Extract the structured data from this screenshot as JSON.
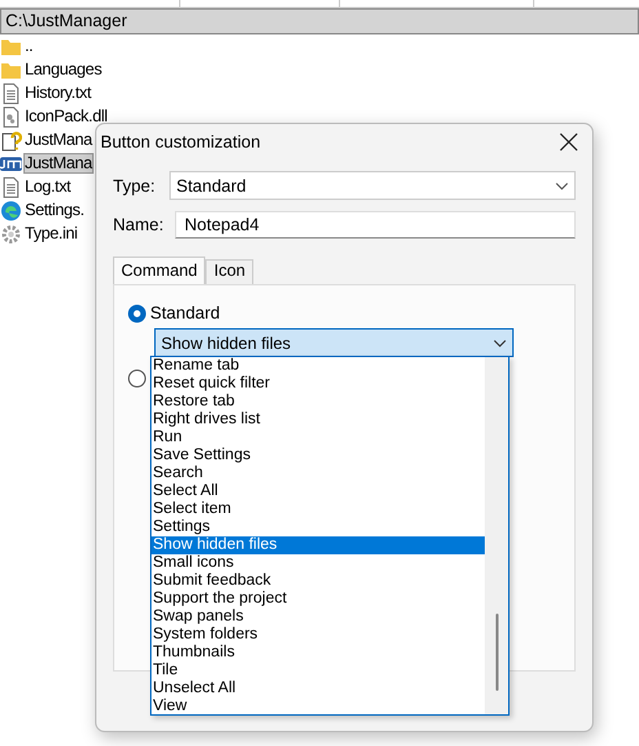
{
  "path_bar": "C:\\JustManager",
  "files": [
    {
      "name": "..",
      "kind": "folder",
      "selected": false
    },
    {
      "name": "Languages",
      "kind": "folder",
      "selected": false
    },
    {
      "name": "History.txt",
      "kind": "text",
      "selected": false
    },
    {
      "name": "IconPack.dll",
      "kind": "library",
      "selected": false
    },
    {
      "name": "JustMana",
      "kind": "help",
      "selected": false
    },
    {
      "name": "JustMana",
      "kind": "app",
      "selected": true
    },
    {
      "name": "Log.txt",
      "kind": "text",
      "selected": false
    },
    {
      "name": "Settings.",
      "kind": "web",
      "selected": false
    },
    {
      "name": "Type.ini",
      "kind": "config",
      "selected": false
    }
  ],
  "dialog": {
    "title": "Button customization",
    "type": {
      "label": "Type:",
      "value": "Standard"
    },
    "name": {
      "label": "Name:",
      "value": "Notepad4"
    },
    "tabs": [
      {
        "label": "Command",
        "selected": true
      },
      {
        "label": "Icon",
        "selected": false
      }
    ],
    "radios": [
      {
        "label": "Standard",
        "checked": true
      },
      {
        "checked": false
      }
    ],
    "combo": {
      "value": "Show hidden files"
    },
    "list": [
      {
        "label": "Rename tab",
        "selected": false
      },
      {
        "label": "Reset quick filter",
        "selected": false
      },
      {
        "label": "Restore tab",
        "selected": false
      },
      {
        "label": "Right drives list",
        "selected": false
      },
      {
        "label": "Run",
        "selected": false
      },
      {
        "label": "Save Settings",
        "selected": false
      },
      {
        "label": "Search",
        "selected": false
      },
      {
        "label": "Select All",
        "selected": false
      },
      {
        "label": "Select item",
        "selected": false
      },
      {
        "label": "Settings",
        "selected": false
      },
      {
        "label": "Show hidden files",
        "selected": true
      },
      {
        "label": "Small icons",
        "selected": false
      },
      {
        "label": "Submit feedback",
        "selected": false
      },
      {
        "label": "Support the project",
        "selected": false
      },
      {
        "label": "Swap panels",
        "selected": false
      },
      {
        "label": "System folders",
        "selected": false
      },
      {
        "label": "Thumbnails",
        "selected": false
      },
      {
        "label": "Tile",
        "selected": false
      },
      {
        "label": "Unselect All",
        "selected": false
      },
      {
        "label": "View",
        "selected": false
      }
    ]
  }
}
